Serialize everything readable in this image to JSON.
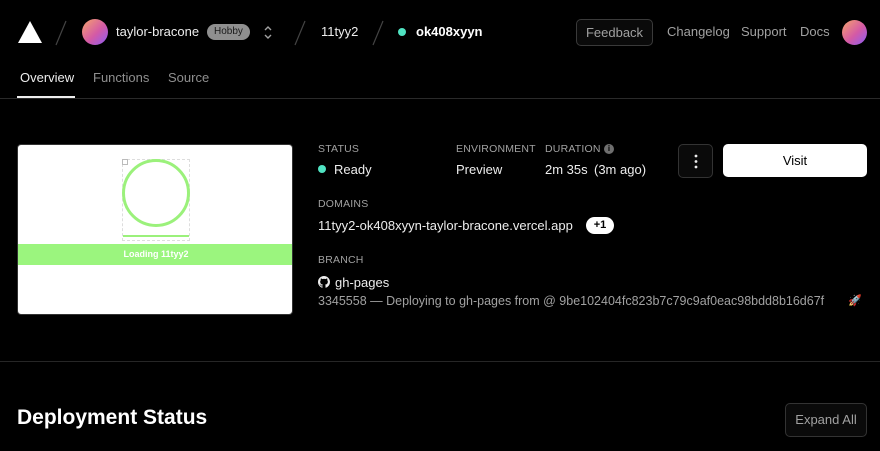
{
  "header": {
    "team_name": "taylor-bracone",
    "plan_badge": "Hobby",
    "project_name": "11tyy2",
    "deployment_name": "ok408xyyn",
    "feedback_label": "Feedback",
    "links": [
      "Changelog",
      "Support",
      "Docs"
    ]
  },
  "tabs": [
    "Overview",
    "Functions",
    "Source"
  ],
  "preview": {
    "loading_text": "Loading 11tyy2",
    "accent_color": "#9bf57e"
  },
  "status": {
    "status_label": "STATUS",
    "status_value": "Ready",
    "environment_label": "ENVIRONMENT",
    "environment_value": "Preview",
    "duration_label": "DURATION",
    "duration_value": "2m 35s",
    "duration_ago": "(3m ago)",
    "info_icon_glyph": "i",
    "ready_color": "#50e3c2"
  },
  "actions": {
    "more_icon": "vertical-ellipsis-icon",
    "visit_label": "Visit"
  },
  "domains": {
    "label": "DOMAINS",
    "primary": "11tyy2-ok408xyyn-taylor-bracone.vercel.app",
    "extra_count": "+1"
  },
  "branch": {
    "label": "BRANCH",
    "name": "gh-pages",
    "commit_text": "3345558 — Deploying to gh-pages from @ 9be102404fc823b7c79c9af0eac98bdd8b16d67f",
    "emoji": "🚀"
  },
  "deployment_status": {
    "title": "Deployment Status",
    "expand_label": "Expand All"
  }
}
